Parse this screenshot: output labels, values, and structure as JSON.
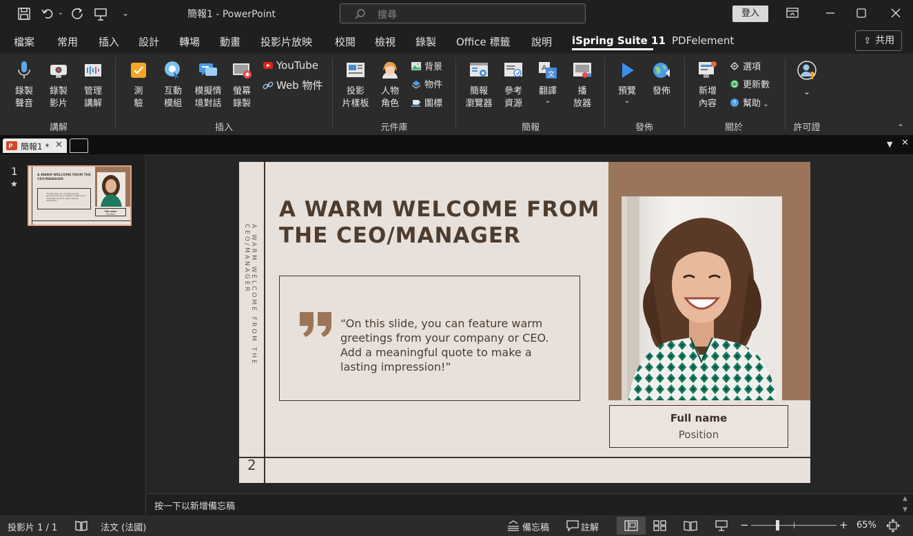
{
  "window": {
    "title": "簡報1  -  PowerPoint",
    "search_placeholder": "搜尋",
    "signin_label": "登入"
  },
  "tabs": [
    {
      "label": "檔案"
    },
    {
      "label": "常用"
    },
    {
      "label": "插入"
    },
    {
      "label": "設計"
    },
    {
      "label": "轉場"
    },
    {
      "label": "動畫"
    },
    {
      "label": "投影片放映"
    },
    {
      "label": "校閱"
    },
    {
      "label": "檢視"
    },
    {
      "label": "錄製"
    },
    {
      "label": "Office 標籤"
    },
    {
      "label": "說明"
    },
    {
      "label": "iSpring Suite 11",
      "active": true
    },
    {
      "label": "PDFelement"
    }
  ],
  "share_label": "共用",
  "ribbon": {
    "record_audio": "錄製\n聲音",
    "record_video": "錄製\n影片",
    "manage_narration": "管理\n講解",
    "quiz": "測\n驗",
    "interaction": "互動\n模組",
    "dialog_sim": "模擬情\n境對話",
    "screen_record": "螢幕\n錄製",
    "youtube": "YouTube",
    "web_object": "Web 物件",
    "slide_template": "投影\n片樣板",
    "character": "人物\n角色",
    "background": "背景",
    "objects": "物件",
    "icons": "圖標",
    "browser": "簡報\n瀏覽器",
    "references": "參考\n資源",
    "translate": "翻譯",
    "player": "播\n放器",
    "preview": "預覽",
    "publish": "發佈",
    "new_content": "新增\n內容",
    "options": "選項",
    "update": "更新數",
    "help": "幫助",
    "groups": {
      "narration": "講解",
      "insert": "插入",
      "library": "元件庫",
      "presentation": "簡報",
      "publish": "發佈",
      "about": "關於",
      "license": "許可證"
    }
  },
  "doc_tab": {
    "label": "簡報1 *"
  },
  "thumbnail": {
    "number": "1",
    "mark": "★",
    "title": "A WARM WELCOME FROM THE CEO/MANAGER",
    "quote": "\"On this slide, you can feature warm greetings from your company or CEO. Add a meaningful quote to make a lasting impression!\"",
    "name": "Full name",
    "position": "Position"
  },
  "slide": {
    "title": "A WARM WELCOME FROM THE CEO/MANAGER",
    "vertical_text": "A WARM WELCOME FROM THE CEO/MANAGER",
    "quote": "“On this slide, you can feature warm greetings from your company or CEO. Add a meaningful quote to make a lasting impression!”",
    "name": "Full name",
    "position": "Position",
    "number": "2"
  },
  "notes_placeholder": "按一下以新增備忘稿",
  "status": {
    "slide_info": "投影片 1 / 1",
    "language": "法文 (法國)",
    "notes": "備忘稿",
    "comments": "註解",
    "zoom_minus": "−",
    "zoom_plus": "+",
    "zoom": "65%",
    "zoom_fraction": 0.65
  },
  "colors": {
    "slide_bg": "#e8e0da",
    "accent": "#9b7559",
    "title": "#4e3d2f"
  }
}
